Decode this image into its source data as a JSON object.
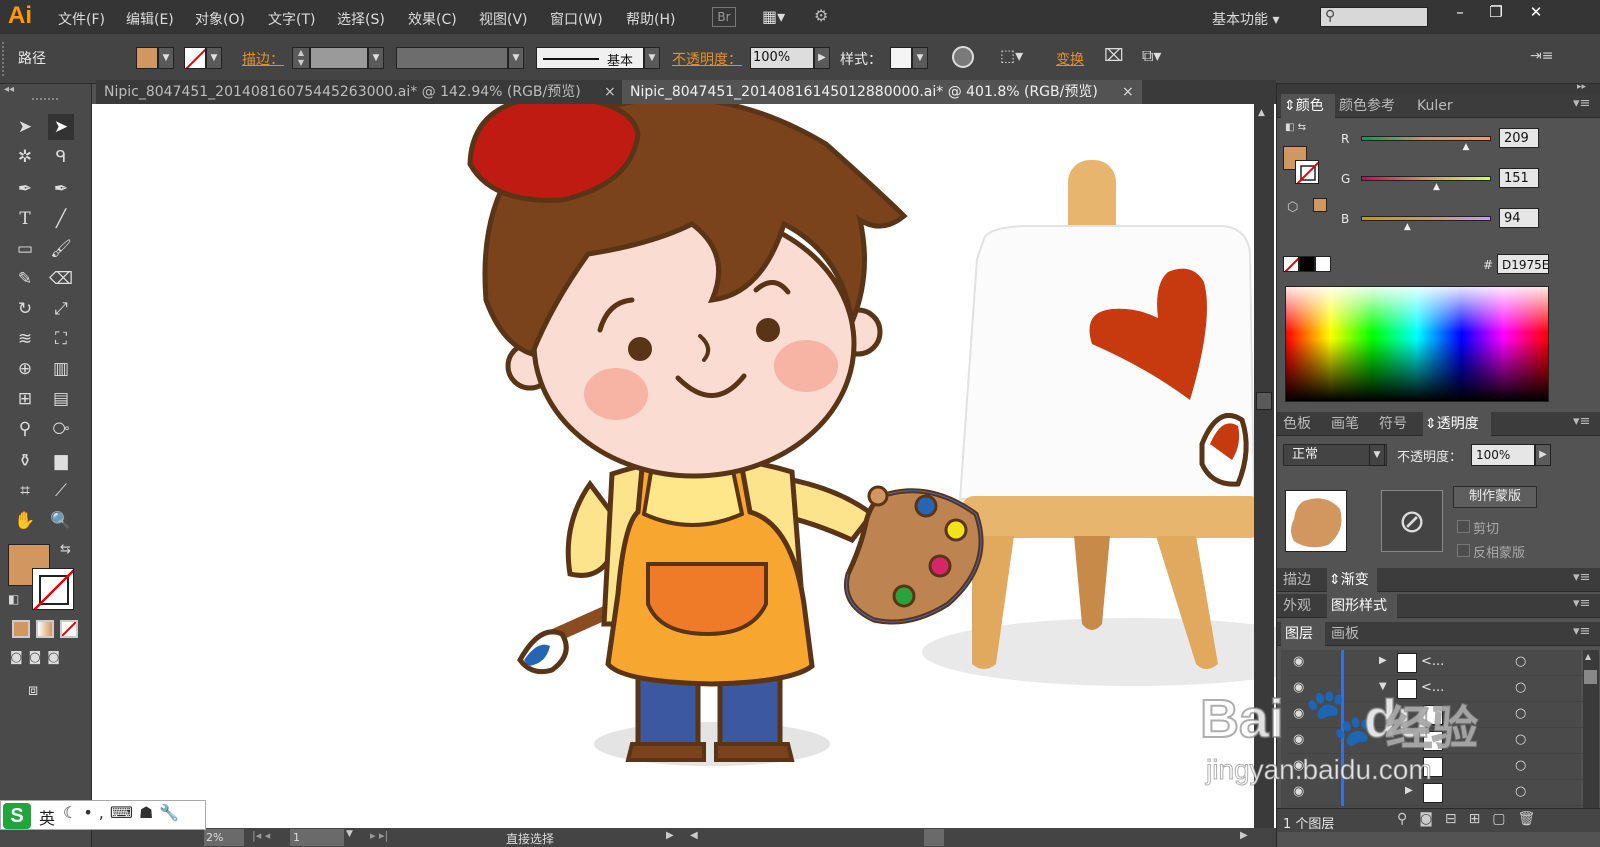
{
  "app": {
    "logo": "Ai"
  },
  "menu": {
    "items": [
      "文件(F)",
      "编辑(E)",
      "对象(O)",
      "文字(T)",
      "选择(S)",
      "效果(C)",
      "视图(V)",
      "窗口(W)",
      "帮助(H)"
    ],
    "bridge": "Br",
    "workspace": "基本功能",
    "search_placeholder": ""
  },
  "control": {
    "path_label": "路径",
    "stroke_label": "描边：",
    "stroke_style": "基本",
    "opacity_label": "不透明度：",
    "opacity_value": "100%",
    "style_label": "样式：",
    "transform_label": "变换",
    "fill_color": "#D1975E"
  },
  "tabs": [
    {
      "label": "Nipic_8047451_20140816075445263000.ai* @ 142.94% (RGB/预览)",
      "active": false
    },
    {
      "label": "Nipic_8047451_20140816145012880000.ai* @ 401.8% (RGB/预览)",
      "active": true
    }
  ],
  "tab_close": "×",
  "color_panel": {
    "tabs": [
      "颜色",
      "颜色参考",
      "Kuler"
    ],
    "r_label": "R",
    "g_label": "G",
    "b_label": "B",
    "r": 209,
    "g": 151,
    "b": 94,
    "hash_label": "#",
    "hex": "D1975E"
  },
  "transparency_panel": {
    "tabs": [
      "色板",
      "画笔",
      "符号",
      "透明度"
    ],
    "mode": "正常",
    "opacity_label": "不透明度：",
    "opacity": "100%",
    "make_mask": "制作蒙版",
    "clip": "剪切",
    "invert": "反相蒙版"
  },
  "stroke_panel": {
    "tabs": [
      "描边",
      "渐变"
    ]
  },
  "appearance_panel": {
    "tabs": [
      "外观",
      "图形样式"
    ]
  },
  "layers_panel": {
    "tabs": [
      "图层",
      "画板"
    ],
    "rows": [
      {
        "name": "<..."
      },
      {
        "name": "<..."
      },
      {
        "name": ""
      },
      {
        "name": ""
      },
      {
        "name": ""
      },
      {
        "name": ""
      }
    ],
    "footer": "1 个图层"
  },
  "status": {
    "zoom": "2%",
    "page": "1",
    "tool": "直接选择"
  },
  "ime": {
    "lang": "英"
  },
  "watermark": {
    "brand": "Bai",
    "brand2": "du",
    "product": "经验",
    "url": "jingyan.baidu.com"
  }
}
